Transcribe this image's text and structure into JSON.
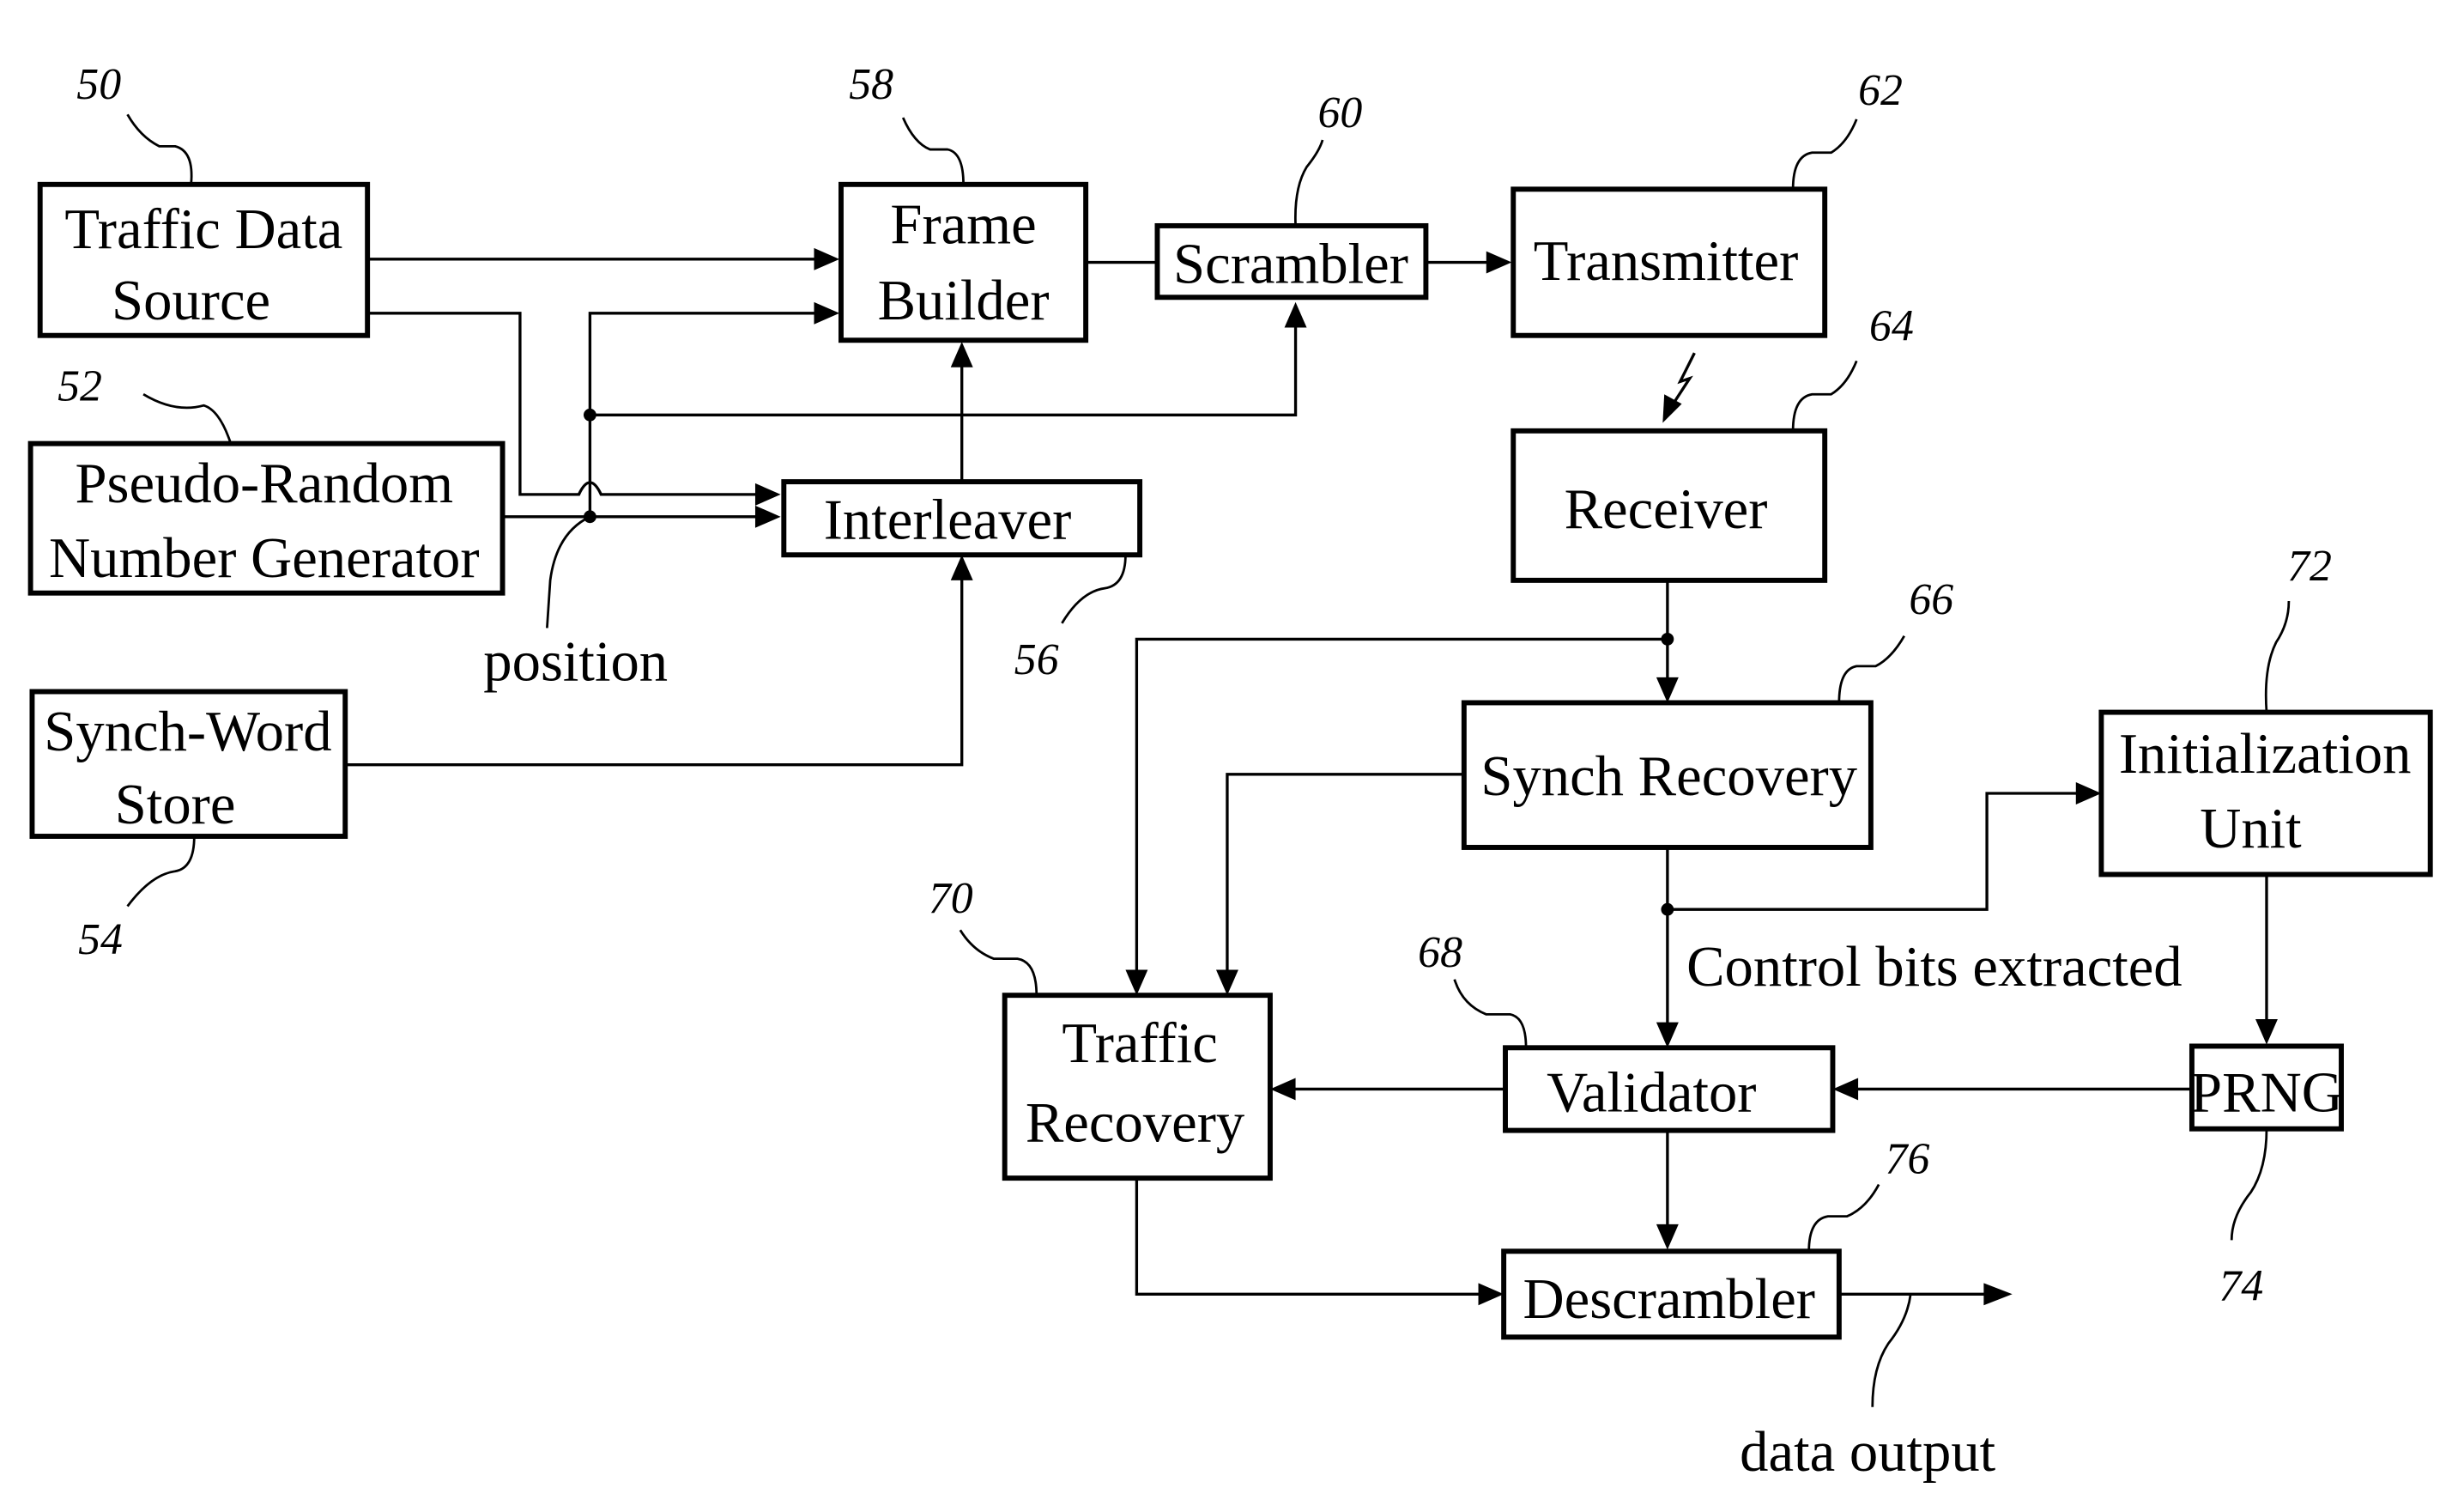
{
  "figure": {
    "blocks": {
      "traffic_data_source": {
        "line1": "Traffic Data",
        "line2": "Source",
        "ref": "50"
      },
      "prng_source": {
        "line1": "Pseudo-Random",
        "line2": "Number Generator",
        "ref": "52"
      },
      "synch_word_store": {
        "line1": "Synch-Word",
        "line2": "Store",
        "ref": "54"
      },
      "interleaver": {
        "label": "Interleaver",
        "ref": "56"
      },
      "frame_builder": {
        "line1": "Frame",
        "line2": "Builder",
        "ref": "58"
      },
      "scrambler": {
        "label": "Scrambler",
        "ref": "60"
      },
      "transmitter": {
        "label": "Transmitter",
        "ref": "62"
      },
      "receiver": {
        "label": "Receiver",
        "ref": "64"
      },
      "synch_recovery": {
        "label": "Synch Recovery",
        "ref": "66"
      },
      "validator": {
        "label": "Validator",
        "ref": "68"
      },
      "traffic_recovery": {
        "line1": "Traffic",
        "line2": "Recovery",
        "ref": "70"
      },
      "initialization_unit": {
        "line1": "Initialization",
        "line2": "Unit",
        "ref": "72"
      },
      "prng_receiver": {
        "label": "PRNG",
        "ref": "74"
      },
      "descrambler": {
        "label": "Descrambler",
        "ref": "76"
      }
    },
    "annotations": {
      "position": "position",
      "control_bits": "Control bits extracted",
      "data_output": "data output"
    },
    "icons": {
      "wireless_link": "lightning-bolt-arrow"
    }
  }
}
